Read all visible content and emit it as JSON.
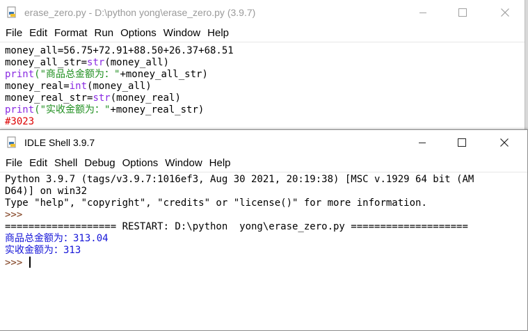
{
  "editor": {
    "title": "erase_zero.py - D:\\python  yong\\erase_zero.py (3.9.7)",
    "menu": [
      "File",
      "Edit",
      "Format",
      "Run",
      "Options",
      "Window",
      "Help"
    ],
    "lines": [
      {
        "a": "money_all=56.75+72.91+88.50+26.37+68.51"
      },
      {
        "a": "money_all_str=",
        "b": "str",
        "c": "(money_all)"
      },
      {
        "a": "print",
        "b": "(\"商品总金额为：\"",
        "c": "+money_all_str)"
      },
      {
        "a": "money_real=",
        "b": "int",
        "c": "(money_all)"
      },
      {
        "a": "money_real_str=",
        "b": "str",
        "c": "(money_real)"
      },
      {
        "a": "print",
        "b": "(\"实收金额为：\"",
        "c": "+money_real_str)"
      },
      {
        "a": "#3023"
      }
    ]
  },
  "shell": {
    "title": "IDLE Shell 3.9.7",
    "menu": [
      "File",
      "Edit",
      "Shell",
      "Debug",
      "Options",
      "Window",
      "Help"
    ],
    "banner1": "Python 3.9.7 (tags/v3.9.7:1016ef3, Aug 30 2021, 20:19:38) [MSC v.1929 64 bit (AM",
    "banner2": "D64)] on win32",
    "banner3": "Type \"help\", \"copyright\", \"credits\" or \"license()\" for more information.",
    "prompt1": ">>> ",
    "restart": "=================== RESTART: D:\\python  yong\\erase_zero.py ====================",
    "out1": "商品总金额为：313.04",
    "out2": "实收金额为：313",
    "prompt2": ">>> "
  }
}
